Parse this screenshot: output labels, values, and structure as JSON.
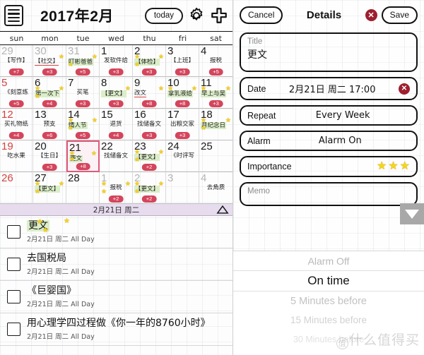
{
  "calendar": {
    "title": "2017年2月",
    "today_label": "today",
    "icons": {
      "menu": "menu-icon",
      "gear": "gear-icon",
      "plus": "plus-icon"
    },
    "weekdays": [
      "sun",
      "mon",
      "tue",
      "wed",
      "thu",
      "fri",
      "sat"
    ],
    "selected_bar": "2月21日 周二",
    "days": [
      {
        "n": "29",
        "dim": true,
        "red": true,
        "evt": "【写作】",
        "badge": "+7",
        "stars": []
      },
      {
        "n": "30",
        "dim": true,
        "evt": "【社交】",
        "badge": "+3",
        "underline": true,
        "stars": [
          "tr"
        ]
      },
      {
        "n": "31",
        "dim": true,
        "evt": "叮彬爸爸",
        "hl": true,
        "badge": "+5",
        "stars": [
          "tr",
          "bl"
        ]
      },
      {
        "n": "1",
        "evt": "发软件给",
        "badge": "+3",
        "stars": []
      },
      {
        "n": "2",
        "evt": "【体检】",
        "hl": true,
        "badge": "+3",
        "stars": [
          "tl",
          "tr",
          "bl"
        ]
      },
      {
        "n": "3",
        "evt": "【上班】",
        "badge": "+3",
        "stars": []
      },
      {
        "n": "4",
        "evt": "报税",
        "badge": "+5",
        "stars": []
      },
      {
        "n": "5",
        "red": true,
        "evt": "《刻意练",
        "badge": "+5",
        "stars": []
      },
      {
        "n": "6",
        "evt": "第一次下",
        "hl": true,
        "badge": "+4",
        "stars": [
          "tl",
          "tr",
          "bl"
        ]
      },
      {
        "n": "7",
        "evt": "买笔",
        "badge": "+3",
        "stars": []
      },
      {
        "n": "8",
        "evt": "【更文】",
        "hl": true,
        "badge": "+3",
        "stars": [
          "tr"
        ]
      },
      {
        "n": "9",
        "evt": "改文",
        "underline": true,
        "badge": "+8",
        "stars": [
          "tr"
        ]
      },
      {
        "n": "10",
        "evt": "拿乳液给",
        "hl": true,
        "badge": "+8",
        "stars": [
          "tl",
          "tr"
        ]
      },
      {
        "n": "11",
        "evt": "早上与吴",
        "hl": true,
        "badge": "+3",
        "stars": [
          "tl",
          "tr"
        ]
      },
      {
        "n": "12",
        "red": true,
        "evt": "买礼物纸",
        "badge": "+4",
        "stars": []
      },
      {
        "n": "13",
        "evt": "预支",
        "badge": "+6",
        "stars": []
      },
      {
        "n": "14",
        "evt": "情人节",
        "hl": true,
        "badge": "+5",
        "stars": [
          "tl",
          "tr",
          "bl"
        ]
      },
      {
        "n": "15",
        "evt": "退货",
        "badge": "+4",
        "stars": []
      },
      {
        "n": "16",
        "evt": "找储备文",
        "badge": "+3",
        "stars": []
      },
      {
        "n": "17",
        "evt": "出粮交家",
        "badge": "+3",
        "stars": []
      },
      {
        "n": "18",
        "evt": "月纪念日",
        "hl": true,
        "badge": "",
        "stars": [
          "tl",
          "tr",
          "bl"
        ]
      },
      {
        "n": "19",
        "red": true,
        "evt": "吃水果",
        "badge": "",
        "stars": []
      },
      {
        "n": "20",
        "evt": "【生日】",
        "badge": "+3",
        "stars": []
      },
      {
        "n": "21",
        "selected": true,
        "evt": "更文",
        "hl": true,
        "badge": "+8",
        "stars": [
          "tl",
          "tr",
          "bl"
        ]
      },
      {
        "n": "22",
        "evt": "找储备文",
        "badge": "",
        "stars": []
      },
      {
        "n": "23",
        "evt": "【更文】",
        "hl": true,
        "badge": "+2",
        "stars": [
          "tl",
          "tr",
          "bl"
        ]
      },
      {
        "n": "24",
        "evt": "《时评写",
        "badge": "",
        "stars": []
      },
      {
        "n": "25",
        "evt": "",
        "badge": "",
        "stars": []
      },
      {
        "n": "26",
        "red": true,
        "evt": "",
        "badge": "",
        "stars": []
      },
      {
        "n": "27",
        "evt": "【更文】",
        "hl": true,
        "badge": "",
        "stars": [
          "tl",
          "tr",
          "bl"
        ]
      },
      {
        "n": "28",
        "evt": "",
        "badge": "",
        "stars": []
      },
      {
        "n": "1",
        "dim": true,
        "evt": "报税",
        "badge": "+2",
        "stars": [
          "tl",
          "tr",
          "bl"
        ]
      },
      {
        "n": "2",
        "dim": true,
        "evt": "【更文】",
        "hl": true,
        "badge": "+2",
        "stars": [
          "tl",
          "tr",
          "bl"
        ]
      },
      {
        "n": "3",
        "dim": true,
        "evt": "",
        "badge": "",
        "stars": []
      },
      {
        "n": "4",
        "dim": true,
        "evt": "去角质",
        "badge": "",
        "stars": []
      }
    ],
    "events": [
      {
        "title": "更文",
        "highlight": true,
        "sub": "2月21日 周二 All Day",
        "stars": true
      },
      {
        "title": "去国税局",
        "highlight": false,
        "sub": "2月21日 周二 All Day",
        "stars": false
      },
      {
        "title": "《巨婴国》",
        "highlight": false,
        "sub": "2月21日 周二 All Day",
        "stars": false
      },
      {
        "title": "用心理学四过程做《你一年的8760小时》",
        "highlight": false,
        "sub": "2月21日 周二 All Day",
        "stars": false
      }
    ]
  },
  "details": {
    "cancel_label": "Cancel",
    "title": "Details",
    "save_label": "Save",
    "close_icon": "✕",
    "title_field": {
      "label": "Title",
      "value": "更文"
    },
    "date_field": {
      "label": "Date",
      "value": "2月21日 周二 17:00",
      "clear_icon": "✕"
    },
    "repeat_field": {
      "label": "Repeat",
      "value": "Every Week"
    },
    "alarm_field": {
      "label": "Alarm",
      "value": "Alarm On"
    },
    "importance_field": {
      "label": "Importance",
      "stars": 3
    },
    "memo_field": {
      "label": "Memo",
      "value": ""
    },
    "picker": {
      "options": [
        "Alarm Off",
        "On time",
        "5 Minutes before",
        "15 Minutes before",
        "30 Minutes before"
      ],
      "selected": "On time"
    },
    "watermark": "什么值得买"
  }
}
